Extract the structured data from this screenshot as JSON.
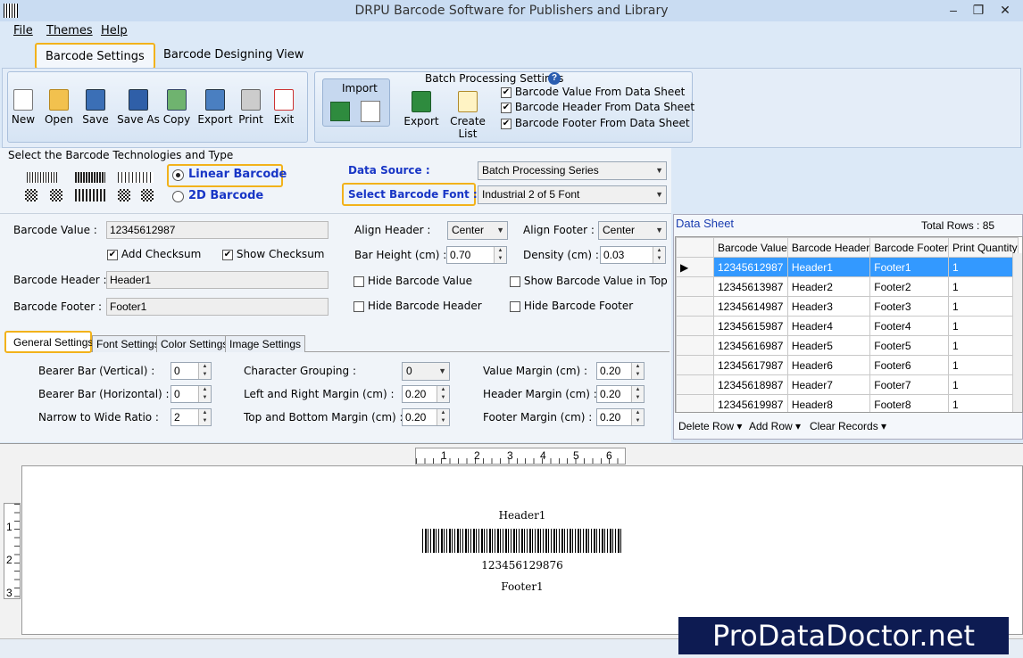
{
  "window": {
    "title": "DRPU Barcode Software for Publishers and Library"
  },
  "menu": [
    "File",
    "Themes",
    "Help"
  ],
  "ribbon_tabs": [
    "Barcode Settings",
    "Barcode Designing View"
  ],
  "toolbar": [
    {
      "label": "New",
      "icon": "new-file-icon"
    },
    {
      "label": "Open",
      "icon": "open-folder-icon"
    },
    {
      "label": "Save",
      "icon": "save-icon"
    },
    {
      "label": "Save As",
      "icon": "save-as-icon"
    },
    {
      "label": "Copy",
      "icon": "copy-icon"
    },
    {
      "label": "Export",
      "icon": "export-icon"
    },
    {
      "label": "Print",
      "icon": "print-icon"
    },
    {
      "label": "Exit",
      "icon": "exit-icon"
    }
  ],
  "import": {
    "title": "Import"
  },
  "batch": {
    "title": "Batch Processing Settings",
    "export": "Export",
    "create_list": "Create List",
    "options": [
      "Barcode Value From Data Sheet",
      "Barcode Header From Data Sheet",
      "Barcode Footer From Data Sheet"
    ]
  },
  "tech": {
    "title": "Select the Barcode Technologies and Type",
    "linear": "Linear Barcode",
    "twod": "2D Barcode"
  },
  "datasource": {
    "label": "Data Source :",
    "value": "Batch Processing Series"
  },
  "font": {
    "label": "Select Barcode Font :",
    "value": "Industrial 2 of 5 Font"
  },
  "form": {
    "barcode_value_label": "Barcode Value :",
    "barcode_value": "12345612987",
    "add_checksum": "Add Checksum",
    "show_checksum": "Show Checksum",
    "header_label": "Barcode Header :",
    "header_value": "Header1",
    "footer_label": "Barcode Footer :",
    "footer_value": "Footer1",
    "align_header_label": "Align Header  :",
    "align_header": "Center",
    "align_footer_label": "Align Footer  :",
    "align_footer": "Center",
    "bar_height_label": "Bar Height (cm) :",
    "bar_height": "0.70",
    "density_label": "Density (cm) :",
    "density": "0.03",
    "hide_value": "Hide Barcode Value",
    "show_top": "Show Barcode Value in Top",
    "hide_header": "Hide Barcode Header",
    "hide_footer": "Hide Barcode Footer"
  },
  "settings_tabs": [
    "General Settings",
    "Font Settings",
    "Color Settings",
    "Image Settings"
  ],
  "general": {
    "bearer_v_label": "Bearer Bar (Vertical) :",
    "bearer_v": "0",
    "bearer_h_label": "Bearer Bar (Horizontal) :",
    "bearer_h": "0",
    "ratio_label": "Narrow to Wide Ratio :",
    "ratio": "2",
    "grouping_label": "Character Grouping  :",
    "grouping": "0",
    "lr_margin_label": "Left and Right Margin (cm) :",
    "lr_margin": "0.20",
    "tb_margin_label": "Top and Bottom Margin (cm) :",
    "tb_margin": "0.20",
    "value_margin_label": "Value Margin (cm) :",
    "value_margin": "0.20",
    "header_margin_label": "Header Margin (cm) :",
    "header_margin": "0.20",
    "footer_margin_label": "Footer Margin (cm) :",
    "footer_margin": "0.20"
  },
  "datasheet": {
    "title": "Data Sheet",
    "total": "Total Rows : 85",
    "columns": [
      "Barcode Value",
      "Barcode Header",
      "Barcode Footer",
      "Print Quantity"
    ],
    "rows": [
      [
        "12345612987",
        "Header1",
        "Footer1",
        "1"
      ],
      [
        "12345613987",
        "Header2",
        "Footer2",
        "1"
      ],
      [
        "12345614987",
        "Header3",
        "Footer3",
        "1"
      ],
      [
        "12345615987",
        "Header4",
        "Footer4",
        "1"
      ],
      [
        "12345616987",
        "Header5",
        "Footer5",
        "1"
      ],
      [
        "12345617987",
        "Header6",
        "Footer6",
        "1"
      ],
      [
        "12345618987",
        "Header7",
        "Footer7",
        "1"
      ],
      [
        "12345619987",
        "Header8",
        "Footer8",
        "1"
      ]
    ],
    "actions": [
      "Delete Row",
      "Add Row",
      "Clear Records"
    ]
  },
  "ruler": {
    "h": [
      "1",
      "2",
      "3",
      "4",
      "5",
      "6"
    ],
    "v": [
      "1",
      "2",
      "3"
    ]
  },
  "preview": {
    "header": "Header1",
    "value": "123456129876",
    "footer": "Footer1"
  },
  "watermark": "ProDataDoctor.net"
}
